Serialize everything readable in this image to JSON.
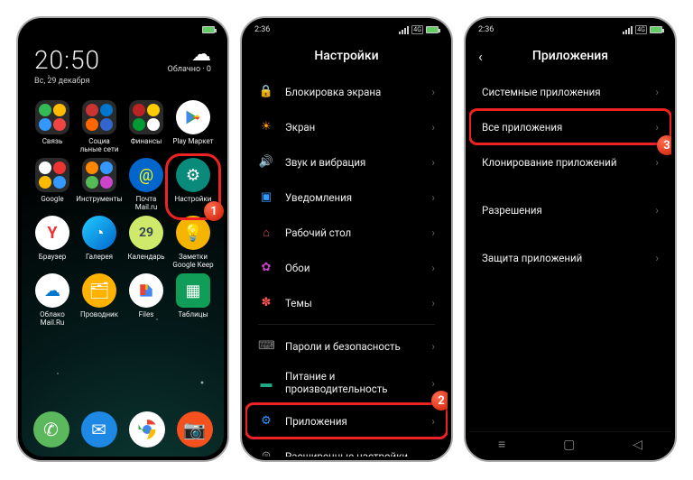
{
  "home": {
    "clock": "20:50",
    "date": "Вс, 29 декабря",
    "weather_label": "Облачно · 0",
    "apps": [
      "Связь",
      "Социа\nльные сети",
      "Финансы",
      "Play Маркет",
      "Google",
      "Инструменты",
      "Почта\nMail.ru",
      "Настройки",
      "Браузер",
      "Галерея",
      "Календарь",
      "Заметки\nGoogle Keep",
      "Облако\nMail.Ru",
      "Проводник",
      "Files",
      "Таблицы"
    ],
    "calendar_day": "29",
    "badge1": "1"
  },
  "settings": {
    "status_time": "2:36",
    "title": "Настройки",
    "items": [
      {
        "icon": "🔒",
        "color": "#d77",
        "label": "Блокировка экрана"
      },
      {
        "icon": "☀",
        "color": "#f90",
        "label": "Экран"
      },
      {
        "icon": "🔊",
        "color": "#6c6",
        "label": "Звук и вибрация"
      },
      {
        "icon": "▣",
        "color": "#39f",
        "label": "Уведомления"
      },
      {
        "icon": "⌂",
        "color": "#d55",
        "label": "Рабочий стол"
      },
      {
        "icon": "✿",
        "color": "#c4c",
        "label": "Обои"
      },
      {
        "icon": "✽",
        "color": "#f55",
        "label": "Темы"
      }
    ],
    "items2": [
      {
        "icon": "⌨",
        "color": "#888",
        "label": "Пароли и безопасность"
      },
      {
        "icon": "▬",
        "color": "#2a8",
        "label": "Питание и\nпроизводительность"
      },
      {
        "icon": "⚙",
        "color": "#39f",
        "label": "Приложения"
      },
      {
        "icon": "⊜",
        "color": "#888",
        "label": "Расширенные настройки"
      }
    ],
    "badge2": "2"
  },
  "apps_page": {
    "status_time": "2:36",
    "title": "Приложения",
    "rows": [
      "Системные приложения",
      "Все приложения",
      "Клонирование приложений",
      "Разрешения",
      "Защита приложений"
    ],
    "badge3": "3"
  }
}
